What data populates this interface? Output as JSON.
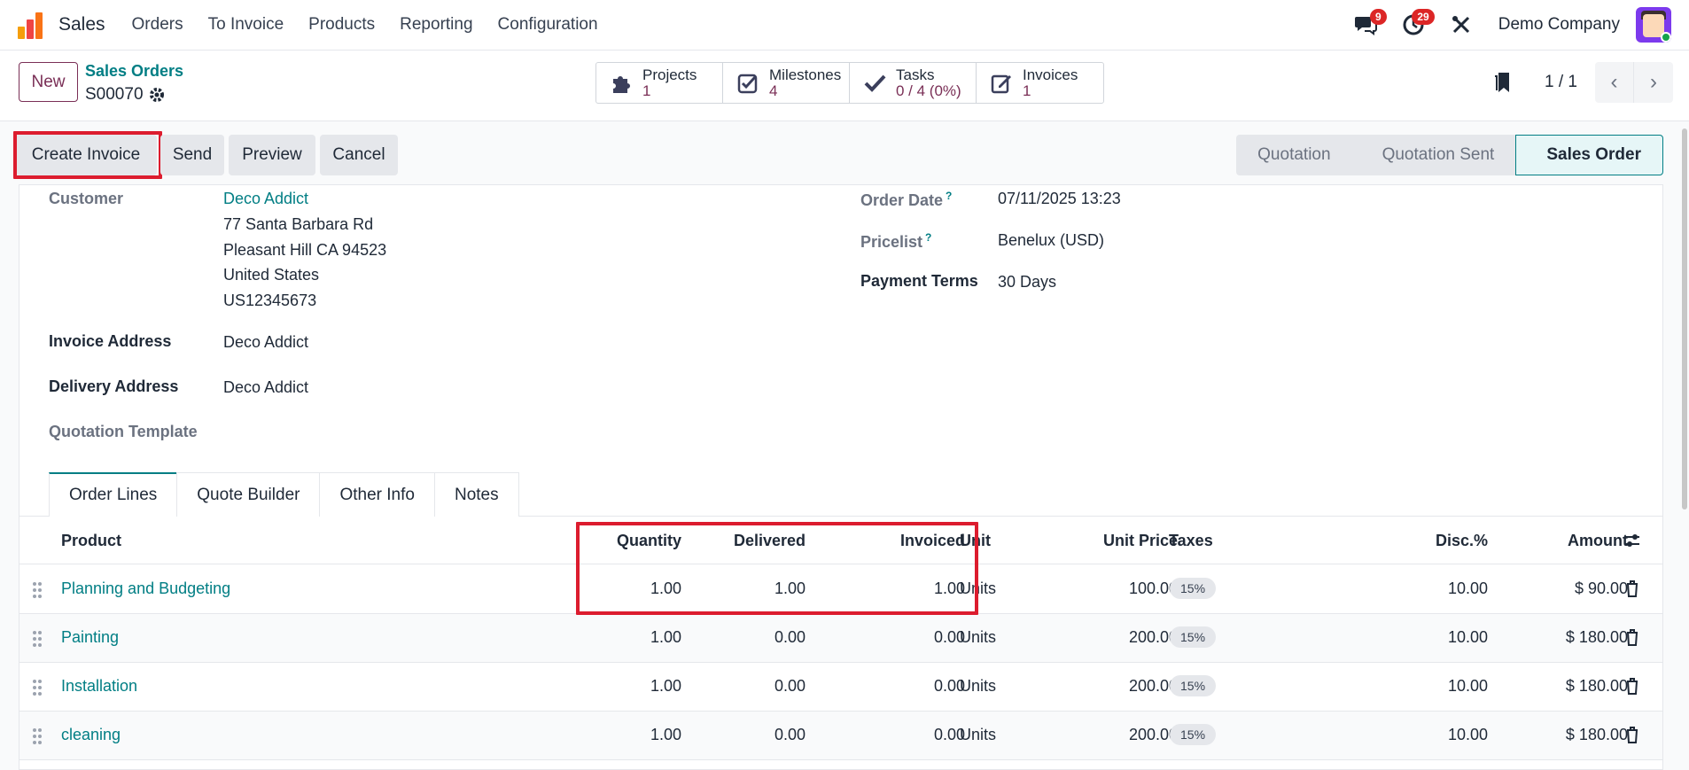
{
  "navbar": {
    "app_name": "Sales",
    "menu": [
      "Orders",
      "To Invoice",
      "Products",
      "Reporting",
      "Configuration"
    ],
    "messages_count": "9",
    "activities_count": "29",
    "company": "Demo Company"
  },
  "control": {
    "new_label": "New",
    "breadcrumb": "Sales Orders",
    "record_name": "S00070",
    "smart_buttons": [
      {
        "label": "Projects",
        "value": "1",
        "icon": "puzzle-icon"
      },
      {
        "label": "Milestones",
        "value": "4",
        "icon": "check-square-icon"
      },
      {
        "label": "Tasks",
        "value": "0 / 4 (0%)",
        "icon": "check-icon"
      },
      {
        "label": "Invoices",
        "value": "1",
        "icon": "edit-icon"
      }
    ],
    "pager": "1 / 1"
  },
  "actions": {
    "create_invoice": "Create Invoice",
    "send": "Send",
    "preview": "Preview",
    "cancel": "Cancel"
  },
  "stages": [
    "Quotation",
    "Quotation Sent",
    "Sales Order"
  ],
  "form": {
    "customer_label": "Customer",
    "customer_name": "Deco Addict",
    "customer_address": [
      "77 Santa Barbara Rd",
      "Pleasant Hill CA 94523",
      "United States",
      "US12345673"
    ],
    "invoice_address_label": "Invoice Address",
    "invoice_address": "Deco Addict",
    "delivery_address_label": "Delivery Address",
    "delivery_address": "Deco Addict",
    "quotation_template_label": "Quotation Template",
    "order_date_label": "Order Date",
    "order_date": "07/11/2025 13:23",
    "pricelist_label": "Pricelist",
    "pricelist": "Benelux (USD)",
    "payment_terms_label": "Payment Terms",
    "payment_terms": "30 Days",
    "help_mark": "?"
  },
  "tabs": [
    "Order Lines",
    "Quote Builder",
    "Other Info",
    "Notes"
  ],
  "table": {
    "headers": {
      "product": "Product",
      "quantity": "Quantity",
      "delivered": "Delivered",
      "invoiced": "Invoiced",
      "unit": "Unit",
      "unit_price": "Unit Price",
      "taxes": "Taxes",
      "disc": "Disc.%",
      "amount": "Amount"
    },
    "rows": [
      {
        "product": "Planning and Budgeting",
        "quantity": "1.00",
        "delivered": "1.00",
        "invoiced": "1.00",
        "unit": "Units",
        "unit_price": "100.00",
        "tax": "15%",
        "disc": "10.00",
        "amount": "$ 90.00"
      },
      {
        "product": "Painting",
        "quantity": "1.00",
        "delivered": "0.00",
        "invoiced": "0.00",
        "unit": "Units",
        "unit_price": "200.00",
        "tax": "15%",
        "disc": "10.00",
        "amount": "$ 180.00"
      },
      {
        "product": "Installation",
        "quantity": "1.00",
        "delivered": "0.00",
        "invoiced": "0.00",
        "unit": "Units",
        "unit_price": "200.00",
        "tax": "15%",
        "disc": "10.00",
        "amount": "$ 180.00"
      },
      {
        "product": "cleaning",
        "quantity": "1.00",
        "delivered": "0.00",
        "invoiced": "0.00",
        "unit": "Units",
        "unit_price": "200.00",
        "tax": "15%",
        "disc": "10.00",
        "amount": "$ 180.00"
      }
    ]
  },
  "colors": {
    "brand": "#7a2f56",
    "link": "#017e84",
    "highlight": "#dc1c2e"
  }
}
